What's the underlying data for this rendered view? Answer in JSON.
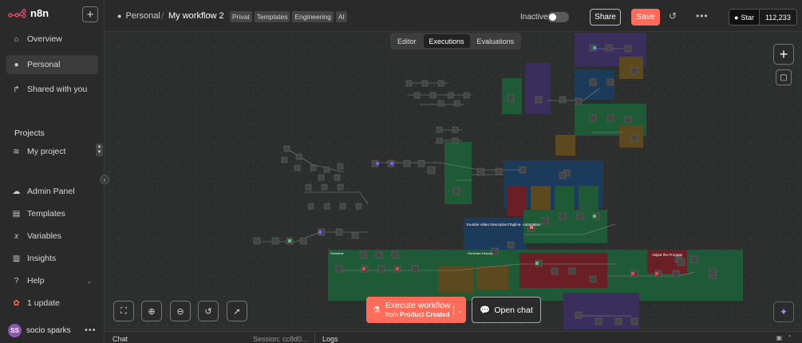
{
  "app": {
    "name": "n8n"
  },
  "sidebar": {
    "items": [
      {
        "label": "Overview",
        "icon": "home-icon"
      },
      {
        "label": "Personal",
        "icon": "user-icon",
        "active": true
      },
      {
        "label": "Shared with you",
        "icon": "share-icon"
      }
    ],
    "projects_title": "Projects",
    "project": {
      "label": "My project",
      "icon": "layers-icon"
    },
    "bottom_items": [
      {
        "label": "Admin Panel",
        "icon": "cloud-icon"
      },
      {
        "label": "Templates",
        "icon": "box-icon"
      },
      {
        "label": "Variables",
        "icon": "variable-icon"
      },
      {
        "label": "Insights",
        "icon": "chart-icon"
      },
      {
        "label": "Help",
        "icon": "help-icon"
      },
      {
        "label": "1 update",
        "icon": "gift-icon"
      }
    ],
    "user": {
      "initials": "SS",
      "name": "socio sparks"
    }
  },
  "header": {
    "breadcrumb_project": "Personal",
    "workflow_name": "My workflow 2",
    "tags": [
      "Privat",
      "Templates",
      "Engineering",
      "AI"
    ],
    "status_label": "Inactive",
    "share_label": "Share",
    "save_label": "Save",
    "github": {
      "star_label": "Star",
      "count": "112,233"
    }
  },
  "canvas": {
    "tabs": [
      {
        "label": "Editor",
        "active": false
      },
      {
        "label": "Executions",
        "active": true
      },
      {
        "label": "Evaluations",
        "active": false
      }
    ],
    "execute": {
      "label": "Execute workflow",
      "from_prefix": "from",
      "trigger": "Product Created"
    },
    "open_chat_label": "Open chat",
    "note_labels": {
      "youtube": "Youtube Video Description/Tagline- Automation",
      "adjust": "Adjust the Prompts",
      "schedule": "Schedule",
      "generate": "Generate Descrip"
    }
  },
  "bottom_panel": {
    "chat_label": "Chat",
    "session_label": "Session: cc8d0...",
    "logs_label": "Logs"
  },
  "colors": {
    "accent": "#ff6d5a",
    "note_green": "#1e5a36",
    "note_blue": "#1c3a5a",
    "note_purple": "#3a2e5c",
    "note_red": "#6a1f24",
    "note_brown": "#5c4a1e"
  }
}
